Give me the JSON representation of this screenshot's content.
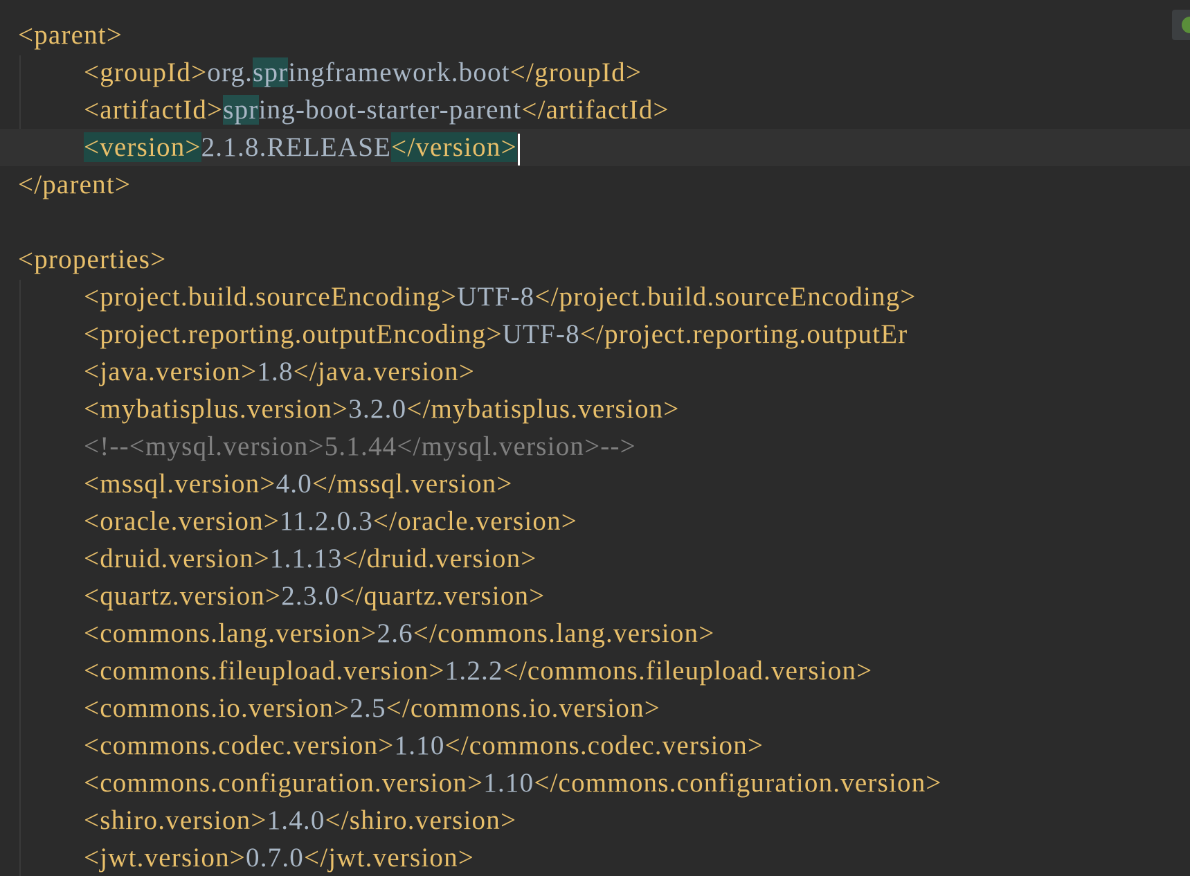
{
  "editor": {
    "parent_block": {
      "open": "<parent>",
      "group_open": "<groupId>",
      "group_prefix": "org.",
      "group_match": "spr",
      "group_rest": "ingframework.boot",
      "group_close": "</groupId>",
      "artifact_open": "<artifactId>",
      "artifact_match": "spr",
      "artifact_rest": "ing-boot-starter-parent",
      "artifact_close": "</artifactId>",
      "version_open": "<version>",
      "version_value": "2.1.8.RELEASE",
      "version_close": "</version>",
      "close": "</parent>"
    },
    "properties_open": "<properties>",
    "properties": [
      {
        "open": "<project.build.sourceEncoding>",
        "value": "UTF-8",
        "close": "</project.build.sourceEncoding>"
      },
      {
        "open": "<project.reporting.outputEncoding>",
        "value": "UTF-8",
        "close": "</project.reporting.outputEr"
      },
      {
        "open": "<java.version>",
        "value": "1.8",
        "close": "</java.version>"
      },
      {
        "open": "<mybatisplus.version>",
        "value": "3.2.0",
        "close": "</mybatisplus.version>"
      },
      {
        "comment": "<!--<mysql.version>5.1.44</mysql.version>-->"
      },
      {
        "open": "<mssql.version>",
        "value": "4.0",
        "close": "</mssql.version>"
      },
      {
        "open": "<oracle.version>",
        "value": "11.2.0.3",
        "close": "</oracle.version>"
      },
      {
        "open": "<druid.version>",
        "value": "1.1.13",
        "close": "</druid.version>"
      },
      {
        "open": "<quartz.version>",
        "value": "2.3.0",
        "close": "</quartz.version>"
      },
      {
        "open": "<commons.lang.version>",
        "value": "2.6",
        "close": "</commons.lang.version>"
      },
      {
        "open": "<commons.fileupload.version>",
        "value": "1.2.2",
        "close": "</commons.fileupload.version>"
      },
      {
        "open": "<commons.io.version>",
        "value": "2.5",
        "close": "</commons.io.version>"
      },
      {
        "open": "<commons.codec.version>",
        "value": "1.10",
        "close": "</commons.codec.version>"
      },
      {
        "open": "<commons.configuration.version>",
        "value": "1.10",
        "close": "</commons.configuration.version>"
      },
      {
        "open": "<shiro.version>",
        "value": "1.4.0",
        "close": "</shiro.version>"
      },
      {
        "open": "<jwt.version>",
        "value": "0.7.0",
        "close": "</jwt.version>"
      }
    ],
    "colors": {
      "background": "#2b2b2b",
      "tag": "#e8bf6a",
      "text": "#a9b7c6",
      "comment": "#808080",
      "search_highlight": "#234f4c"
    }
  }
}
